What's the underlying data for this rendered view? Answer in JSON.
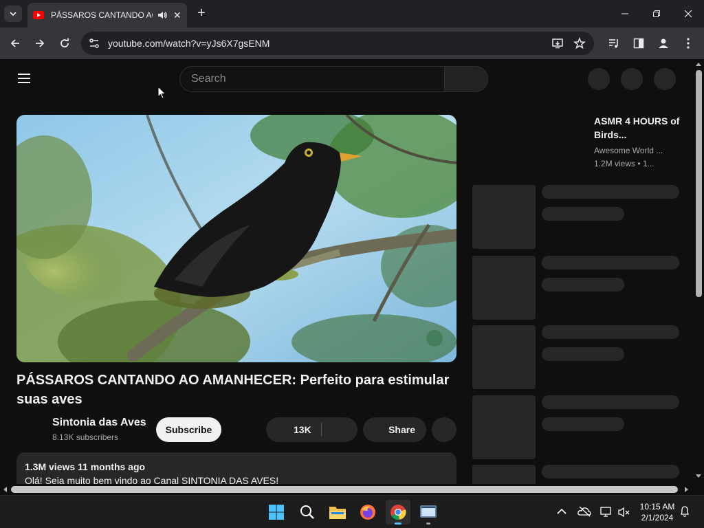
{
  "browser": {
    "tab_title": "PÁSSAROS CANTANDO AO AMANHECER",
    "url": "youtube.com/watch?v=yJs6X7gsENM",
    "tab_close": "✕",
    "new_tab": "+"
  },
  "youtube": {
    "search_placeholder": "Search",
    "video_title": "PÁSSAROS CANTANDO AO AMANHECER: Perfeito para estimular suas aves",
    "channel_name": "Sintonia das Aves",
    "subscribers": "8.13K subscribers",
    "subscribe_label": "Subscribe",
    "like_count": "13K",
    "share_label": "Share",
    "description_meta": "1.3M views  11 months ago",
    "description_text": "Olá! Seja muito bem vindo ao Canal SINTONIA DAS AVES!",
    "recommendation": {
      "title": "ASMR 4 HOURS of Birds...",
      "channel": "Awesome World ...",
      "views": "1.2M views  • 1..."
    }
  },
  "taskbar": {
    "time": "10:15 AM",
    "date": "2/1/2024",
    "apps": [
      "start-icon",
      "search-icon",
      "file-explorer-icon",
      "firefox-icon",
      "chrome-icon",
      "terminal-icon"
    ]
  },
  "colors": {
    "youtube_red": "#ff0000",
    "background": "#0f0f0f",
    "chip": "#272727"
  }
}
